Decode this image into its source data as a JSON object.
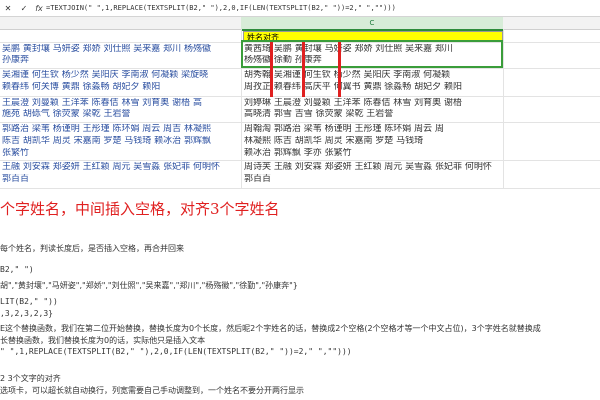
{
  "formula_bar": {
    "fx": "fx",
    "formula": "=TEXTJOIN(\" \",1,REPLACE(TEXTSPLIT(B2,\" \"),2,0,IF(LEN(TEXTSPLIT(B2,\" \"))=2,\"  \",\"\")))"
  },
  "col_headers": {
    "c": "C"
  },
  "table_header": "姓名对齐",
  "left_rows": [
    [
      "吴鹏 黄封壤 马妍姿 郑娇 刘仕照 吴来嘉 郑川 杨殇徽",
      "孙康奔"
    ],
    [
      "吴湘谨 何生钦 杨少然 吴阳庆 李南淑 何凝颖 梁旋晓",
      "赖春纬 何关博 黄鼎 徐淼畅 胡妃夕 赖阳"
    ],
    [
      "王晨澄 刘曼颖 王洋苯 陈春佶 林雪 刘育奥 谢梧 高",
      "施苑 胡砾气 徐荧蒙 梁乾 王岩誉"
    ],
    [
      "郭路治 梁苇 杨谨明 王彤瑾 陈环娟 周云 周吉 林凝熙",
      "陈吉 胡凯华 周灵 宋嘉南 罗楚 马钱琦 赖冰治 郭辉飘",
      "张繁竹"
    ],
    [
      "王融 刘安霖 郑姿妍 王红颖 周元 吴雪淼 张妃菲 何明怀",
      "郭百百"
    ]
  ],
  "right_rows": [
    [
      "黄茜琦 吴鹏 黄封壤 马妍姿 郑娇 刘仕照 吴来嘉 郑川",
      "杨殇徽 徐勤 孙康奔"
    ],
    [
      "胡秀翰 吴湘谨 何生钦 杨少然 吴阳庆 李南淑 何凝颖",
      "周孜芷 赖春纬 高庆平 何翼书 黄鼎 徐淼畅 胡妃夕 赖阳"
    ],
    [
      "刘婷琳 王晨澄 刘曼颖 王洋苯 陈春佶 林雪 刘育奥 谢梧",
      "高晓清 郭雪 吉雪 徐荧蒙 梁乾 王岩誉"
    ],
    [
      "周翰淘 郭路治 梁苇 杨谨明 王彤瑾 陈环娟 周云 周",
      "林凝熙 陈吉 胡凯华 周灵 宋嘉南 罗楚 马钱琦",
      "赖冰治 郭辉飘 李亦 张繁竹"
    ],
    [
      "周诗芙 王融 刘安霖 郑姿妍 王红颖 周元 吴雪淼 张妃菲 何明怀",
      "郭百百"
    ]
  ],
  "heading": "个字姓名，中间插入空格，对齐3个字姓名",
  "notes": [
    "每个姓名，判读长度后，是否插入空格，再合并回来",
    "B2,\" \")",
    "胡\",\"黄封壤\",\"马妍姿\",\"郑娇\",\"刘仕照\",\"吴来嘉\",\"郑川\",\"杨殇徽\",\"徐勤\",\"孙康奔\"}",
    "LIT(B2,\" \"))",
    ",3,2,3,2,3}",
    "E这个替换函数，我们在第二位开始替换，替换长度为0个长度，然后呢2个字姓名的话，替换成2个空格(2个空格才等一个中文占位)，3个字姓名就替换成",
    "长替换函数，我们替换长度为0的话，实际他只是插入文本",
    "\" \",1,REPLACE(TEXTSPLIT(B2,\" \"),2,0,IF(LEN(TEXTSPLIT(B2,\" \"))=2,\"  \",\"\")))",
    "2 3个文字的对齐",
    "选项卡，可以超长就自动换行，列宽需要自己手动调整到，一个姓名不要分开两行显示"
  ]
}
